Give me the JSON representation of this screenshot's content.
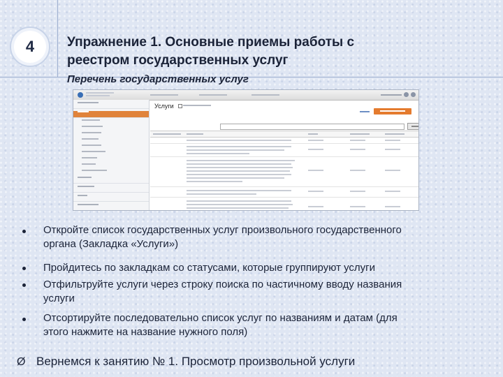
{
  "slide": {
    "number": "4",
    "title_line1": "Упражнение 1. Основные приемы работы с",
    "title_line2": "реестром государственных услуг",
    "subtitle": "Перечень государственных услуг"
  },
  "screenshot": {
    "main": {
      "heading": "Услуги"
    }
  },
  "bullets": [
    {
      "lines": [
        "Откройте список государственных услуг произвольного государственного",
        "органа (Закладка «Услуги»)"
      ]
    },
    {
      "lines": [
        "Пройдитесь по закладкам со статусами, которые группируют услуги"
      ]
    },
    {
      "lines": [
        "Отфильтруйте услуги через строку поиска по частичному вводу названия",
        "услуги"
      ]
    },
    {
      "lines": [
        "Отсортируйте последовательно список услуг по названиям и датам (для",
        "этого нажмите на название нужного поля)"
      ]
    }
  ],
  "footer": {
    "arrow_glyph": "Ø",
    "text": "Вернемся к занятию № 1. Просмотр произвольной услуги"
  },
  "colors": {
    "accent": "#e47b2e",
    "title_text": "#1b2338",
    "background": "#dfe6f3"
  }
}
